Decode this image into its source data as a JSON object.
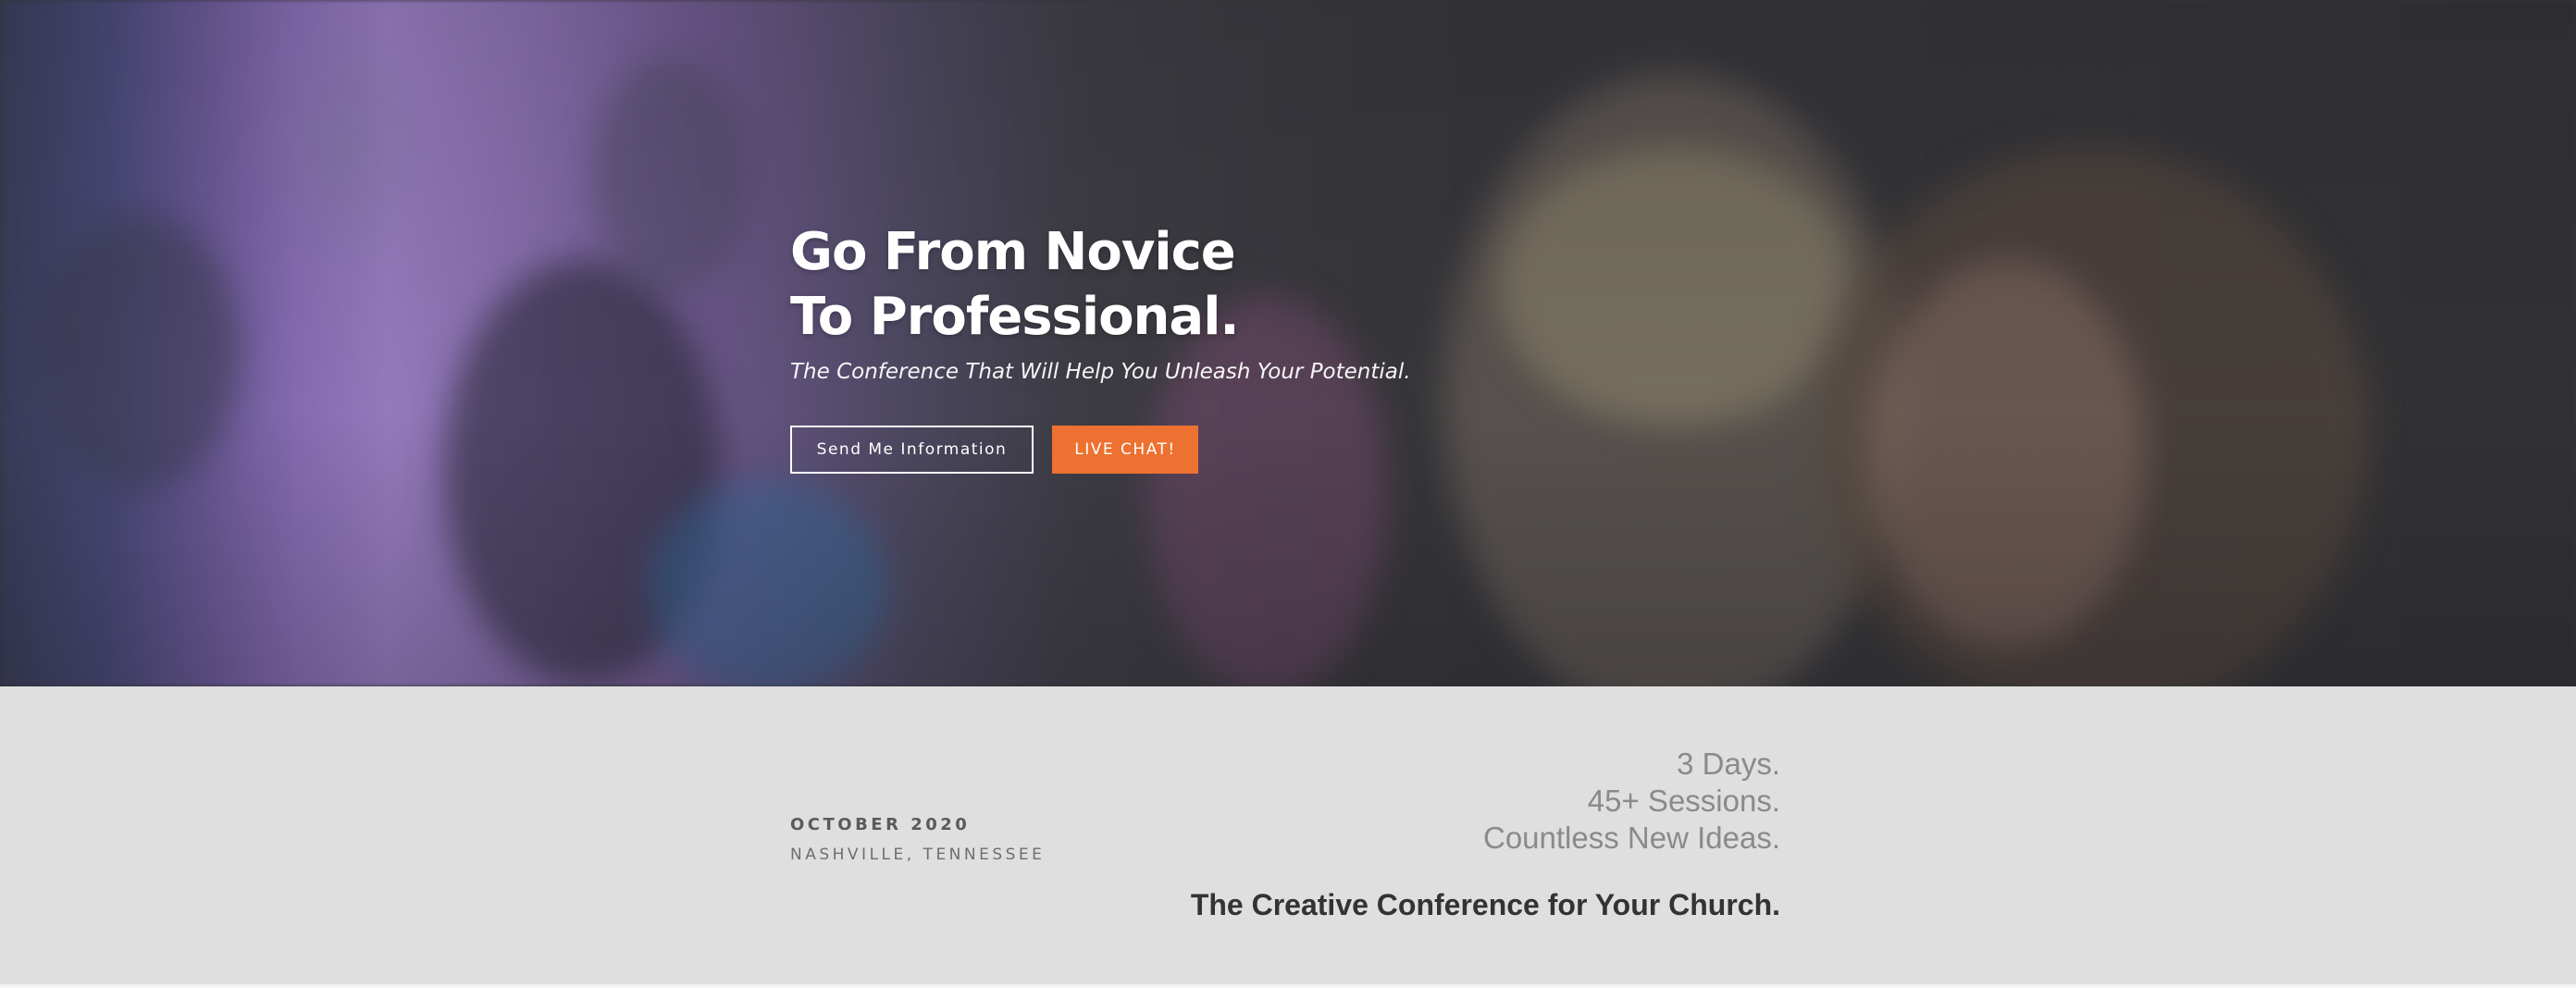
{
  "hero": {
    "title_line1": "Go From Novice",
    "title_line2": "To Professional.",
    "subtitle": "The Conference That Will Help You Unleash Your Potential.",
    "buttons": {
      "info_label": "Send Me Information",
      "chat_label": "LIVE CHAT!"
    }
  },
  "event": {
    "date": "OCTOBER 2020",
    "location": "NASHVILLE, TENNESSEE"
  },
  "highlights": {
    "lines": [
      "3 Days.",
      "45+ Sessions.",
      "Countless New Ideas."
    ],
    "tagline": "The Creative Conference for Your Church."
  },
  "colors": {
    "accent": "#ed7130",
    "band_background": "#dfdfdf",
    "hero_overlay": "#38373b"
  }
}
